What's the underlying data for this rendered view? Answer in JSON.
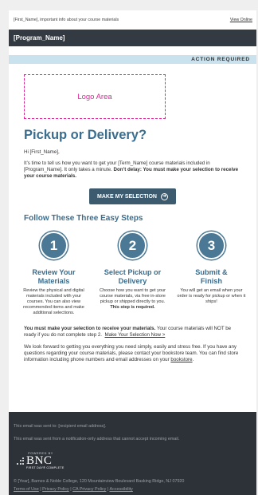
{
  "preheader": {
    "text": "[First_Name], important info about your course materials",
    "view_online": "View Online"
  },
  "program_bar": {
    "name": "[Program_Name]"
  },
  "action_bar": {
    "label": "ACTION REQUIRED"
  },
  "logo": {
    "placeholder": "Logo Area"
  },
  "main": {
    "headline": "Pickup or Delivery?",
    "greeting": "Hi [First_Name],",
    "intro_plain": "It’s time to tell us how you want to get your [Term_Name] course materials included in [Program_Name]. It only takes a minute.",
    "intro_bold": "Don’t delay: You must make your selection to receive your course materials.",
    "cta_label": "MAKE MY SELECTION",
    "cta_icon": "arrow-right-circle-icon"
  },
  "steps": {
    "heading": "Follow These Three Easy Steps",
    "items": [
      {
        "number": "1",
        "title": "Review Your Materials",
        "desc": "Review the physical and digital materials included with your courses. You can also view recommended items and make additional selections.",
        "desc_bold": ""
      },
      {
        "number": "2",
        "title": "Select Pickup or Delivery",
        "desc": "Choose how you want to get your course materials, via free in-store pickup or shipped directly to you.",
        "desc_bold": "This step is required."
      },
      {
        "number": "3",
        "title": "Submit & Finish",
        "desc": "You will get an email when your order is ready for pickup or when it ships!",
        "desc_bold": ""
      }
    ]
  },
  "warning": {
    "bold": "You must make your selection to receive your materials.",
    "plain": "Your course materials will NOT be ready if you do not complete step 2.",
    "link": "Make Your Selection Now >"
  },
  "forward": {
    "text": "We look forward to getting you everything you need simply, easily and stress free. If you have any questions regarding your course materials, please contact your bookstore team. You can find store information including phone numbers and email addresses on your",
    "link": "bookstore",
    "end": "."
  },
  "footer": {
    "sent_to": "This email was sent to: [recipient email address].",
    "notification": "This email was sent from a notification-only address that cannot accept incoming email.",
    "powered_by": "POWERED BY",
    "brand": "BNC",
    "brand_tag": "FIRST DAY® COMPLETE",
    "address": "© [Year], Barnes & Noble College, 120 Mountainview Boulevard Basking Ridge, NJ 07920",
    "links": [
      "Terms of Use",
      "Privacy Policy",
      "CA Privacy Policy",
      "Accessibility"
    ],
    "separator": "|"
  },
  "colors": {
    "program_bar": "#333a42",
    "action_bar": "#c9e2ee",
    "accent_blue": "#3a6d8e",
    "cta": "#3c5b6f",
    "logo_dash": "#e0249a",
    "footer_bg": "#2d3239"
  }
}
